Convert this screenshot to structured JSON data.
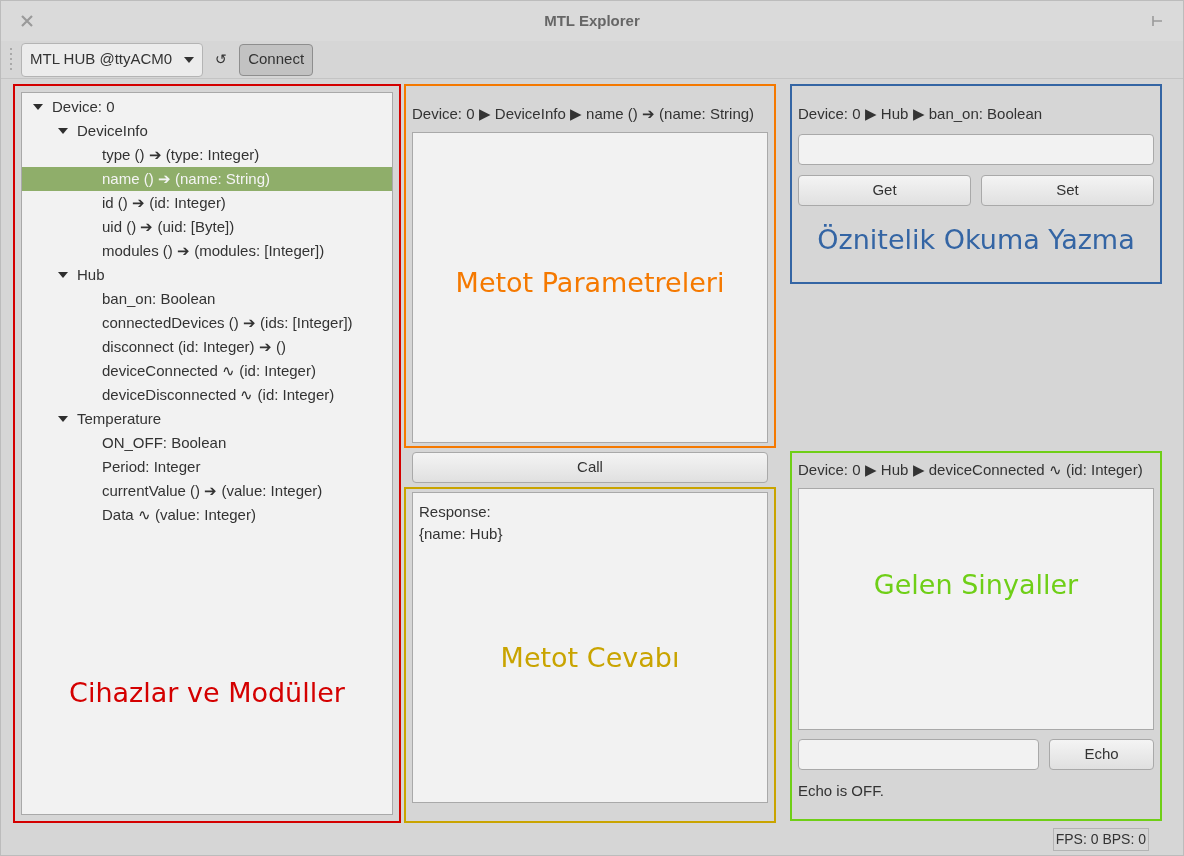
{
  "window": {
    "title": "MTL Explorer"
  },
  "toolbar": {
    "device_select": {
      "value": "MTL HUB @ttyACM0"
    },
    "refresh": "↺",
    "connect": {
      "label": "Connect",
      "pressed": true
    }
  },
  "device_tree": {
    "annotation": {
      "text": "Cihazlar ve Modüller",
      "color": "#d40000"
    },
    "items": [
      {
        "label": "Device: 0",
        "expanded": true,
        "selected": false,
        "children": [
          {
            "label": "DeviceInfo",
            "expanded": true,
            "selected": false,
            "children": [
              {
                "label": "type () ➔ (type: Integer)",
                "selected": false
              },
              {
                "label": "name () ➔ (name: String)",
                "selected": true
              },
              {
                "label": "id () ➔ (id: Integer)",
                "selected": false
              },
              {
                "label": "uid () ➔ (uid: [Byte])",
                "selected": false
              },
              {
                "label": "modules () ➔ (modules: [Integer])",
                "selected": false
              }
            ]
          },
          {
            "label": "Hub",
            "expanded": true,
            "selected": false,
            "children": [
              {
                "label": "ban_on: Boolean",
                "selected": false
              },
              {
                "label": "connectedDevices () ➔ (ids: [Integer])",
                "selected": false
              },
              {
                "label": "disconnect (id: Integer) ➔ ()",
                "selected": false
              },
              {
                "label": "deviceConnected ∿ (id: Integer)",
                "selected": false
              },
              {
                "label": "deviceDisconnected ∿ (id: Integer)",
                "selected": false
              }
            ]
          },
          {
            "label": "Temperature",
            "expanded": true,
            "selected": false,
            "children": [
              {
                "label": "ON_OFF: Boolean",
                "selected": false
              },
              {
                "label": "Period: Integer",
                "selected": false
              },
              {
                "label": "currentValue () ➔ (value: Integer)",
                "selected": false
              },
              {
                "label": "Data ∿ (value: Integer)",
                "selected": false
              }
            ]
          }
        ]
      }
    ]
  },
  "method": {
    "path": "Device: 0 ▶ DeviceInfo ▶ name () ➔ (name: String)",
    "annotation": {
      "text": "Metot Parametreleri",
      "color": "#f57900"
    },
    "call_button": "Call"
  },
  "response": {
    "lines": [
      "Response:",
      "{name: Hub}"
    ],
    "annotation": {
      "text": "Metot Cevabı",
      "color": "#c9a400"
    }
  },
  "attribute": {
    "path": "Device: 0 ▶ Hub ▶ ban_on: Boolean",
    "buttons": [
      "Get",
      "Set"
    ],
    "annotation": {
      "text": "Öznitelik Okuma Yazma",
      "color": "#3465a4"
    }
  },
  "signals": {
    "path": "Device: 0 ▶ Hub ▶ deviceConnected ∿ (id: Integer)",
    "echo_button": "Echo",
    "echo_status": "Echo is OFF.",
    "annotation": {
      "text": "Gelen Sinyaller",
      "color": "#6fcf17"
    }
  },
  "status_bar": {
    "stats": "FPS: 0 BPS: 0"
  }
}
